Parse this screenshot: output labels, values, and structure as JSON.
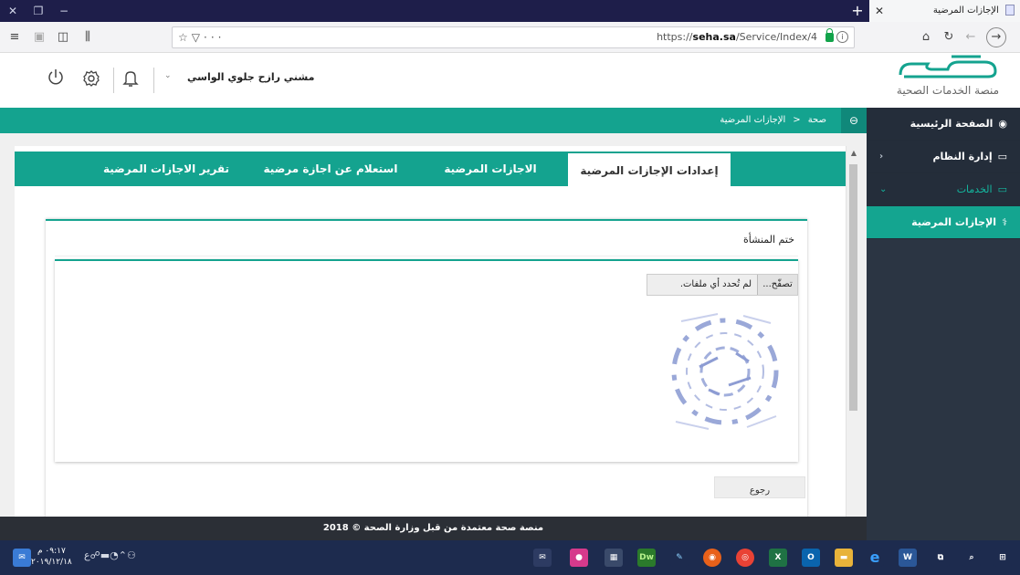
{
  "browser": {
    "tab_title": "الإجازات المرضية",
    "url_host": "seha.sa",
    "url_prefix": "https://",
    "url_path": "/Service/Index/4"
  },
  "header": {
    "brand_tagline": "منصة الخدمات الصحية",
    "user_name": "مشني رازح جلوي الواسي"
  },
  "sidebar": {
    "items": [
      {
        "label": "الصفحة الرئيسية"
      },
      {
        "label": "إدارة النظام"
      },
      {
        "label": "الخدمات"
      },
      {
        "label": "الإجازات المرضية"
      }
    ]
  },
  "breadcrumb": {
    "root": "صحة",
    "separator": "<",
    "current": "الإجازات المرضية"
  },
  "tabs": [
    {
      "label": "إعدادات الإجازات المرضية",
      "active": true
    },
    {
      "label": "الاجازات المرضية",
      "active": false
    },
    {
      "label": "استعلام عن اجازة مرضية",
      "active": false
    },
    {
      "label": "تقرير الاجازات المرضية",
      "active": false
    }
  ],
  "form": {
    "section_title": "ختم المنشأة",
    "browse_label": "تصفّح...",
    "file_status": "لم تُحدد أي ملفات.",
    "back_label": "رجوع"
  },
  "footer": {
    "text": "منصة صحة معتمدة من قبل وزارة الصحة © 2018"
  },
  "taskbar": {
    "time": "٠٩:١٧ م",
    "date": "٢٠١٩/١٢/١٨"
  },
  "colors": {
    "teal": "#14a38f",
    "sidebar_bg": "#2b3543",
    "footer_bg": "#2b2f36"
  }
}
